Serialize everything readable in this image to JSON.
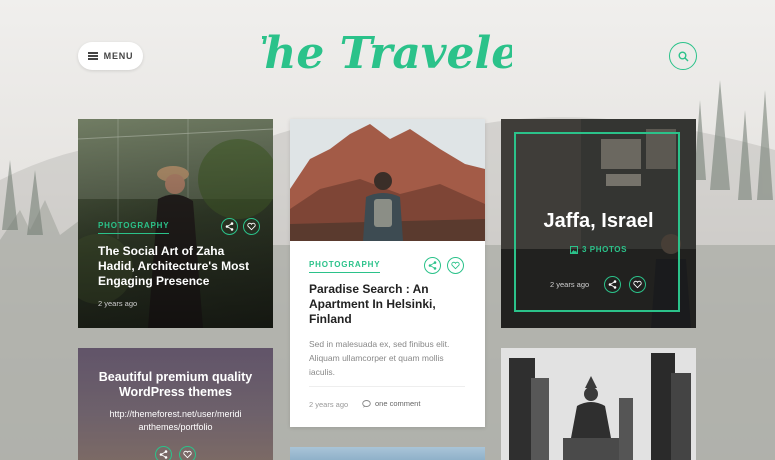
{
  "header": {
    "menu_label": "MENU",
    "logo_text": "The Traveler"
  },
  "icons": {
    "menu": "hamburger-icon",
    "search": "search-icon",
    "share": "share-icon",
    "like": "heart-icon",
    "photos": "image-icon",
    "comment": "comment-icon"
  },
  "colors": {
    "accent": "#2bc28a"
  },
  "cards": {
    "zaha": {
      "category": "PHOTOGRAPHY",
      "title": "The Social Art of Zaha Hadid, Architecture's Most Engaging Presence",
      "date": "2 years ago"
    },
    "paradise": {
      "category": "PHOTOGRAPHY",
      "title": "Paradise Search : An Apartment In Helsinki, Finland",
      "excerpt": "Sed in malesuada ex, sed finibus elit. Aliquam ullamcorper et quam mollis iaculis.",
      "date": "2 years ago",
      "comments": "one comment"
    },
    "jaffa": {
      "title": "Jaffa, Israel",
      "photos": "3 PHOTOS",
      "date": "2 years ago"
    },
    "promo": {
      "title": "Beautiful premium quality WordPress themes",
      "url": "http://themeforest.net/user/meridianthemes/portfolio"
    }
  }
}
